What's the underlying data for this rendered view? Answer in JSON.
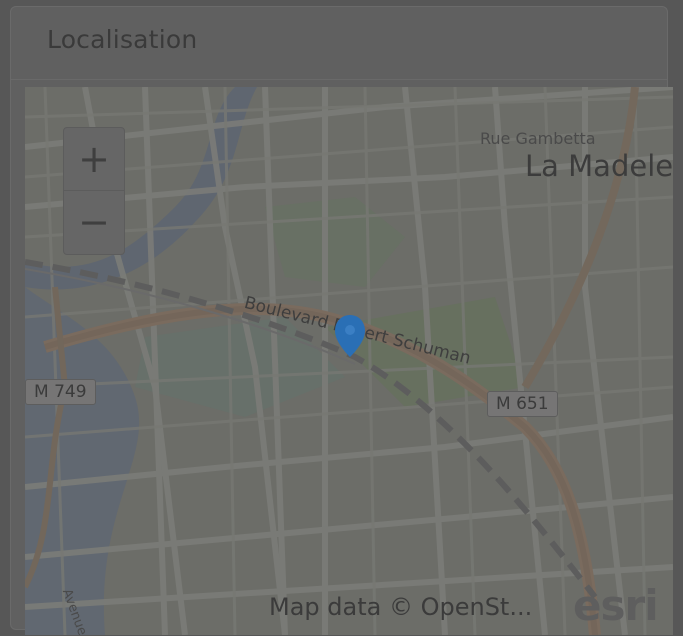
{
  "card": {
    "title": "Localisation"
  },
  "map": {
    "zoom_in_label": "+",
    "zoom_out_label": "−",
    "attribution": "Map data © OpenSt...",
    "logo": "esri",
    "labels": {
      "district": "La Madele",
      "street_top": "Rue Gambetta",
      "boulevard": "Boulevard Robert Schuman",
      "side_street": "Avenue de"
    },
    "road_shields": [
      "M 749",
      "M 651"
    ],
    "marker": {
      "icon": "map-pin-icon",
      "color": "#2a6fb5"
    }
  }
}
